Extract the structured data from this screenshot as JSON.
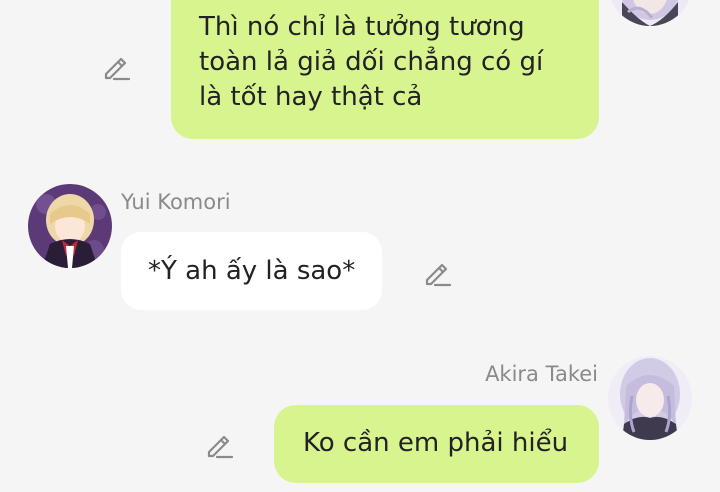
{
  "messages": [
    {
      "text": "Thì nó chỉ là tưởng tương\ntoàn lả giả dối chẳng có gí\nlà tốt hay thật cả",
      "side": "right"
    },
    {
      "sender": "Yui Komori",
      "text": "*Ý ah ấy là sao*",
      "side": "left"
    },
    {
      "sender": "Akira Takei",
      "text": "Ko cần em phải hiểu",
      "side": "right"
    }
  ],
  "icons": {
    "edit": "pencil-edit-icon"
  },
  "colors": {
    "background": "#f5f5f5",
    "outgoing_bubble": "#d8f48e",
    "incoming_bubble": "#ffffff",
    "sender_name": "#8a8a8a",
    "icon": "#8a8a8a"
  }
}
